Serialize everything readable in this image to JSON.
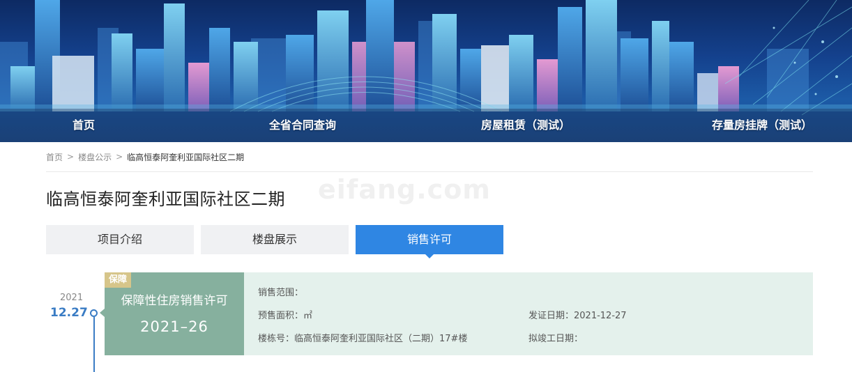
{
  "nav": {
    "items": [
      {
        "label": "首页"
      },
      {
        "label": "全省合同查询"
      },
      {
        "label": "房屋租赁（测试）"
      },
      {
        "label": "存量房挂牌（测试）"
      }
    ]
  },
  "breadcrumb": {
    "items": [
      "首页",
      "楼盘公示",
      "临高恒泰阿奎利亚国际社区二期"
    ],
    "separator": ">"
  },
  "watermark": "eifang.com",
  "page": {
    "title": "临高恒泰阿奎利亚国际社区二期"
  },
  "tabs": [
    {
      "label": "项目介绍",
      "active": false
    },
    {
      "label": "楼盘展示",
      "active": false
    },
    {
      "label": "销售许可",
      "active": true
    }
  ],
  "timeline": {
    "year": "2021",
    "date": "12.27"
  },
  "permit": {
    "badge": "保障",
    "type": "保障性住房销售许可",
    "number": "2021–26",
    "fields": {
      "sale_scope": {
        "label": "销售范围：",
        "value": ""
      },
      "presale_area": {
        "label": "预售面积：",
        "value": "㎡"
      },
      "issue_date": {
        "label": "发证日期：",
        "value": "2021-12-27"
      },
      "building": {
        "label": "楼栋号：",
        "value": "临高恒泰阿奎利亚国际社区（二期）17#楼"
      },
      "completion_date": {
        "label": "拟竣工日期：",
        "value": ""
      }
    }
  },
  "colors": {
    "accent": "#2f86e3",
    "timeline": "#3a7cc4",
    "card_left": "#86b09e",
    "card_right": "#e4f1ec",
    "badge": "#d6c58a"
  }
}
